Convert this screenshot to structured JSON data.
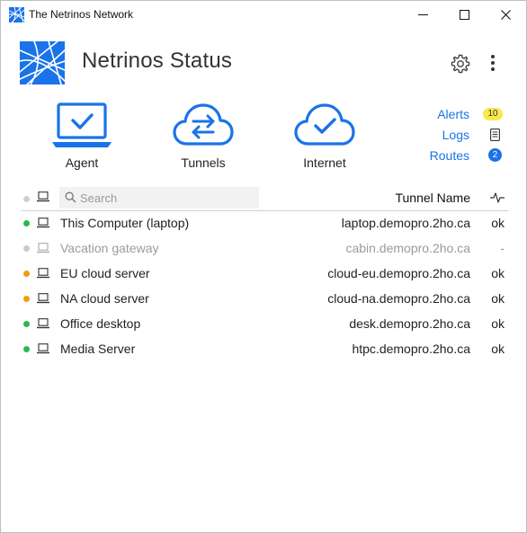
{
  "window": {
    "title": "The Netrinos Network"
  },
  "header": {
    "app_title": "Netrinos Status"
  },
  "tiles": [
    {
      "label": "Agent",
      "icon": "laptop-check-icon"
    },
    {
      "label": "Tunnels",
      "icon": "cloud-arrows-icon"
    },
    {
      "label": "Internet",
      "icon": "cloud-check-icon"
    }
  ],
  "links": {
    "alerts_label": "Alerts",
    "alerts_count": "10",
    "logs_label": "Logs",
    "routes_label": "Routes",
    "routes_count": "2"
  },
  "search": {
    "placeholder": "Search"
  },
  "table": {
    "col_tunnel": "Tunnel Name",
    "rows": [
      {
        "name": "This Computer (laptop)",
        "host": "laptop.demopro.2ho.ca",
        "status": "ok",
        "dot": "#2bb84d"
      },
      {
        "name": "Vacation gateway",
        "host": "cabin.demopro.2ho.ca",
        "status": "-",
        "dot": "#c9c9d6"
      },
      {
        "name": "EU cloud server",
        "host": "cloud-eu.demopro.2ho.ca",
        "status": "ok",
        "dot": "#f29d0c"
      },
      {
        "name": "NA cloud server",
        "host": "cloud-na.demopro.2ho.ca",
        "status": "ok",
        "dot": "#f29d0c"
      },
      {
        "name": "Office desktop",
        "host": "desk.demopro.2ho.ca",
        "status": "ok",
        "dot": "#2bb84d"
      },
      {
        "name": "Media Server",
        "host": "htpc.demopro.2ho.ca",
        "status": "ok",
        "dot": "#2bb84d"
      }
    ]
  },
  "colors": {
    "accent": "#1a73e8",
    "alert_badge": "#f9e94b"
  }
}
